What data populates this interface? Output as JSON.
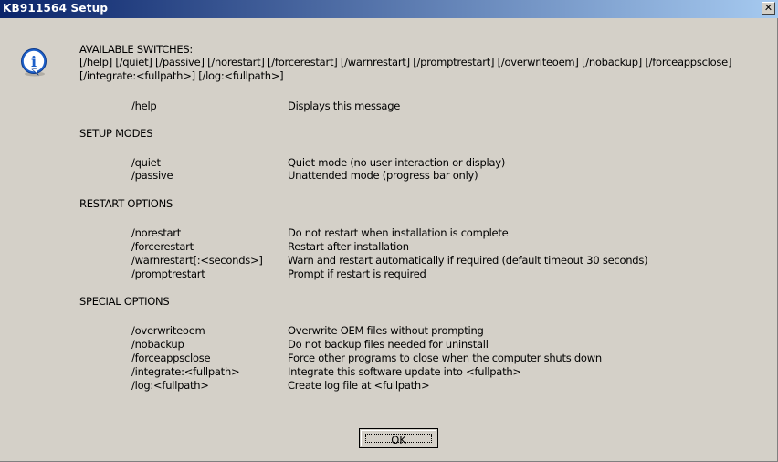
{
  "window": {
    "title": "KB911564 Setup",
    "close_glyph": "✕"
  },
  "content": {
    "header": "AVAILABLE SWITCHES:",
    "switches_line1": "[/help] [/quiet] [/passive] [/norestart] [/forcerestart] [/warnrestart] [/promptrestart] [/overwriteoem] [/nobackup] [/forceappsclose]",
    "switches_line2": "[/integrate:<fullpath>] [/log:<fullpath>]",
    "help": {
      "switch": "/help",
      "desc": "Displays this message"
    },
    "setup_modes": {
      "title": "SETUP MODES",
      "items": [
        {
          "switch": "/quiet",
          "desc": "Quiet mode (no user interaction or display)"
        },
        {
          "switch": "/passive",
          "desc": "Unattended mode (progress bar only)"
        }
      ]
    },
    "restart_options": {
      "title": "RESTART OPTIONS",
      "items": [
        {
          "switch": "/norestart",
          "desc": "Do not restart when installation is complete"
        },
        {
          "switch": "/forcerestart",
          "desc": "Restart after installation"
        },
        {
          "switch": "/warnrestart[:<seconds>]",
          "desc": "Warn and restart automatically if required (default timeout 30 seconds)"
        },
        {
          "switch": "/promptrestart",
          "desc": "Prompt if restart is required"
        }
      ]
    },
    "special_options": {
      "title": "SPECIAL OPTIONS",
      "items": [
        {
          "switch": "/overwriteoem",
          "desc": "Overwrite OEM files without prompting"
        },
        {
          "switch": "/nobackup",
          "desc": "Do not backup files needed for uninstall"
        },
        {
          "switch": "/forceappsclose",
          "desc": "Force other programs to close when the computer shuts down"
        },
        {
          "switch": "/integrate:<fullpath>",
          "desc": "Integrate this software update into <fullpath>"
        },
        {
          "switch": "/log:<fullpath>",
          "desc": "Create log file at <fullpath>"
        }
      ]
    }
  },
  "buttons": {
    "ok": "OK"
  },
  "icon": {
    "name": "information-icon",
    "glyph": "i",
    "color": "#1c5fc9"
  }
}
